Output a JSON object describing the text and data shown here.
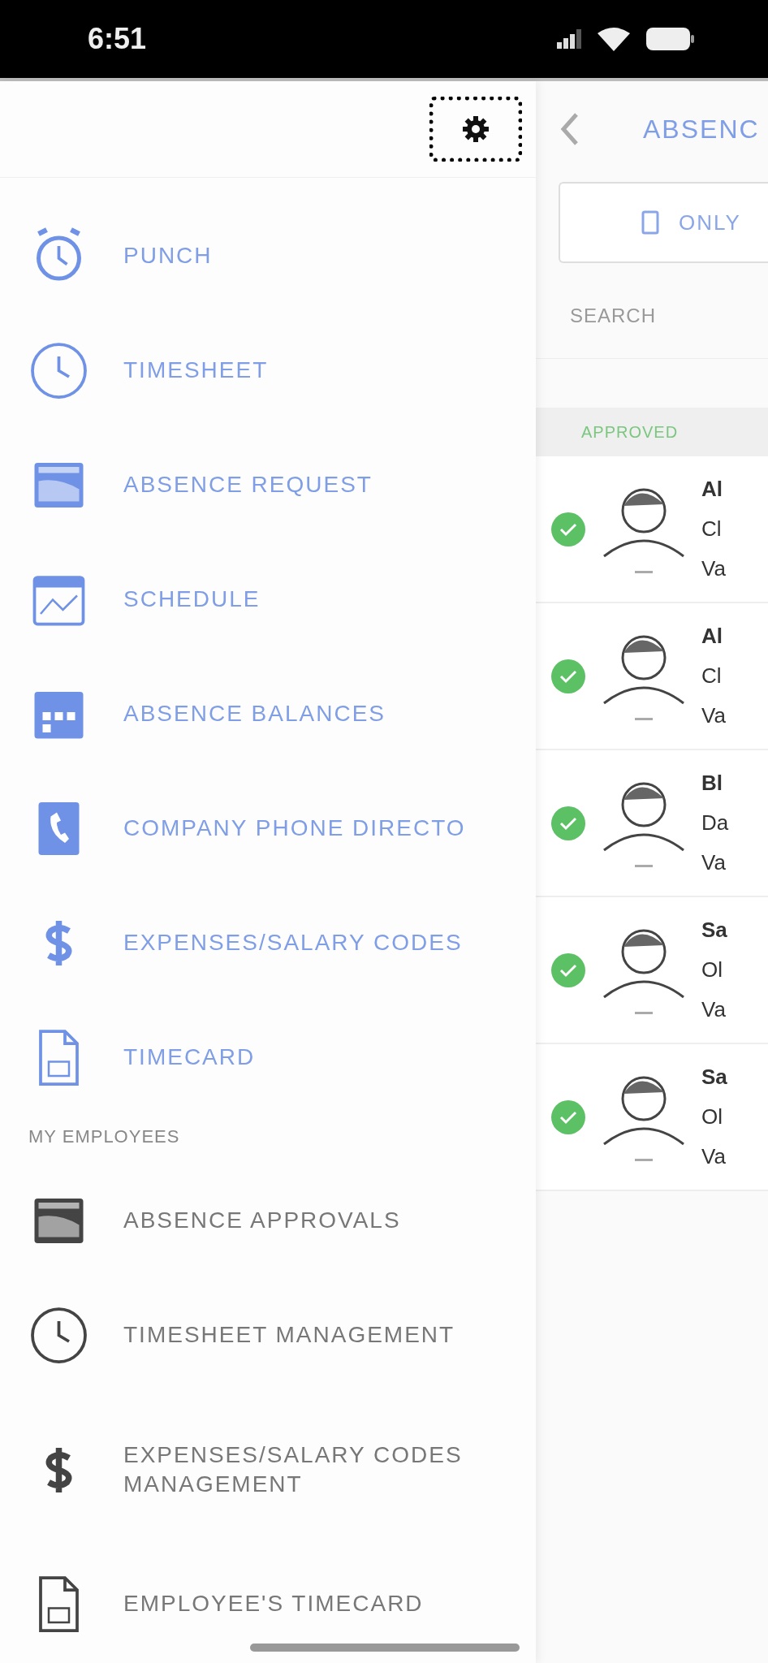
{
  "status_bar": {
    "time": "6:51"
  },
  "drawer": {
    "settings_button": {
      "focused": true
    },
    "items": [
      {
        "label": "PUNCH"
      },
      {
        "label": "TIMESHEET"
      },
      {
        "label": "ABSENCE REQUEST"
      },
      {
        "label": "SCHEDULE"
      },
      {
        "label": "ABSENCE BALANCES"
      },
      {
        "label": "COMPANY PHONE DIRECTO"
      },
      {
        "label": "EXPENSES/SALARY CODES"
      },
      {
        "label": "TIMECARD"
      }
    ],
    "employees_section": {
      "title": "MY EMPLOYEES",
      "items": [
        {
          "label": "ABSENCE APPROVALS"
        },
        {
          "label": "TIMESHEET MANAGEMENT"
        },
        {
          "label": "EXPENSES/SALARY CODES MANAGEMENT"
        },
        {
          "label": "EMPLOYEE'S TIMECARD"
        }
      ]
    }
  },
  "main": {
    "title": "ABSENC",
    "filter_button": "ONLY",
    "search": {
      "placeholder": "SEARCH"
    },
    "section": "APPROVED",
    "rows": [
      {
        "approved": true,
        "line_1": "Al",
        "line_2": "Cl",
        "line_3": "Va"
      },
      {
        "approved": true,
        "line_1": "Al",
        "line_2": "Cl",
        "line_3": "Va"
      },
      {
        "approved": true,
        "line_1": "Bl",
        "line_2": "Da",
        "line_3": "Va"
      },
      {
        "approved": true,
        "line_1": "Sa",
        "line_2": "Ol",
        "line_3": "Va"
      },
      {
        "approved": true,
        "line_1": "Sa",
        "line_2": "Ol",
        "line_3": "Va"
      }
    ]
  }
}
